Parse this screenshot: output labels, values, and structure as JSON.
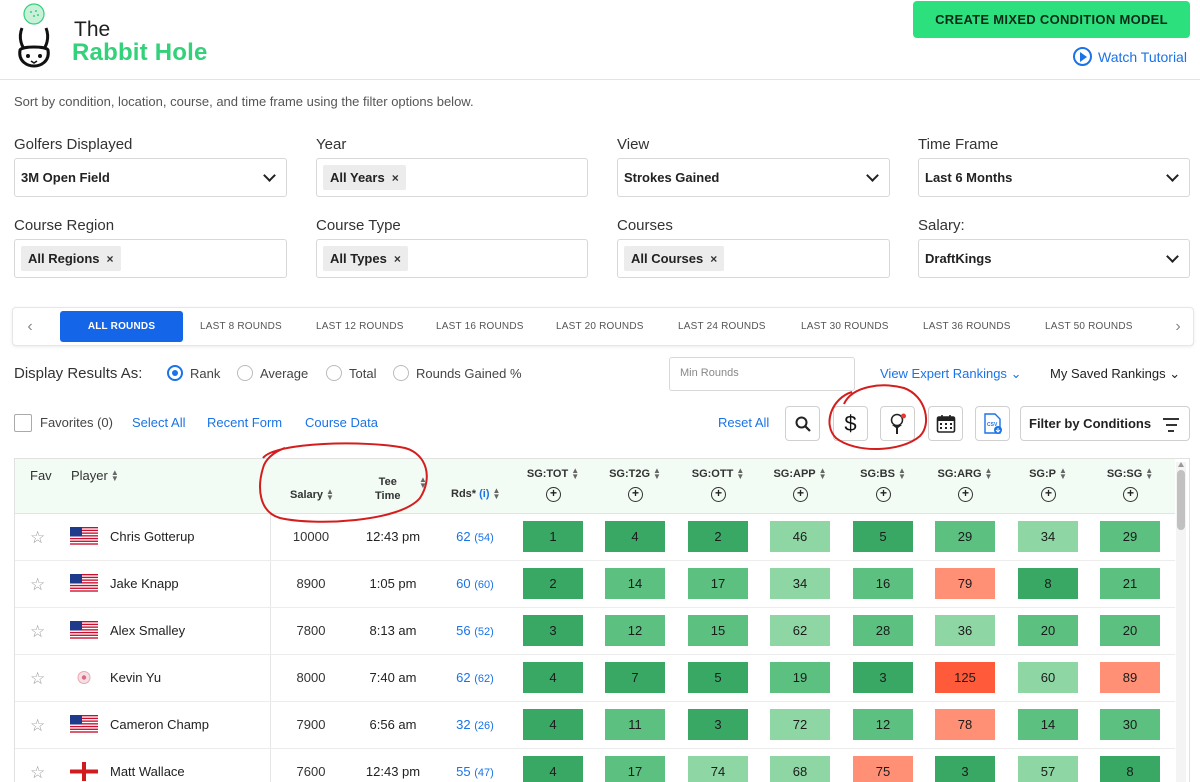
{
  "brand": {
    "line1": "The",
    "line2": "Rabbit Hole"
  },
  "header": {
    "cta_label": "CREATE MIXED CONDITION MODEL",
    "tutorial_label": "Watch Tutorial"
  },
  "subtitle": "Sort by condition, location, course, and time frame using the filter options below.",
  "filters": {
    "golfers": {
      "label": "Golfers Displayed",
      "value": "3M Open Field"
    },
    "year": {
      "label": "Year",
      "chip": "All Years"
    },
    "view": {
      "label": "View",
      "value": "Strokes Gained"
    },
    "timeframe": {
      "label": "Time Frame",
      "value": "Last 6 Months"
    },
    "region": {
      "label": "Course Region",
      "chip": "All Regions"
    },
    "type": {
      "label": "Course Type",
      "chip": "All Types"
    },
    "courses": {
      "label": "Courses",
      "chip": "All Courses"
    },
    "salary": {
      "label": "Salary:",
      "value": "DraftKings"
    }
  },
  "round_tabs": [
    "ALL ROUNDS",
    "LAST 8 ROUNDS",
    "LAST 12 ROUNDS",
    "LAST 16 ROUNDS",
    "LAST 20 ROUNDS",
    "LAST 24 ROUNDS",
    "LAST 30 ROUNDS",
    "LAST 36 ROUNDS",
    "LAST 50 ROUNDS"
  ],
  "display": {
    "label": "Display Results As:",
    "options": [
      "Rank",
      "Average",
      "Total",
      "Rounds Gained %"
    ],
    "selected": "Rank",
    "min_rounds_placeholder": "Min Rounds",
    "expert_label": "View Expert Rankings",
    "saved_label": "My Saved Rankings"
  },
  "toolbar": {
    "favorites": "Favorites (0)",
    "select_all": "Select All",
    "recent_form": "Recent Form",
    "course_data": "Course Data",
    "reset_all": "Reset All",
    "dollar": "$",
    "filter_conditions": "Filter by Conditions"
  },
  "table": {
    "headers": {
      "fav": "Fav",
      "player": "Player",
      "salary": "Salary",
      "tee_line1": "Tee",
      "tee_line2": "Time",
      "rds": "Rds*",
      "rds_info": "(i)",
      "stats": [
        "SG:TOT",
        "SG:T2G",
        "SG:OTT",
        "SG:APP",
        "SG:BS",
        "SG:ARG",
        "SG:P",
        "SG:SG"
      ]
    },
    "rows": [
      {
        "name": "Chris Gotterup",
        "flag": "usa",
        "salary": "10000",
        "tee": "12:43 pm",
        "rds": "62",
        "rds_sub": "(54)",
        "stats": [
          1,
          4,
          2,
          46,
          5,
          29,
          34,
          29
        ]
      },
      {
        "name": "Jake Knapp",
        "flag": "usa",
        "salary": "8900",
        "tee": "1:05 pm",
        "rds": "60",
        "rds_sub": "(60)",
        "stats": [
          2,
          14,
          17,
          34,
          16,
          79,
          8,
          21
        ]
      },
      {
        "name": "Alex Smalley",
        "flag": "usa",
        "salary": "7800",
        "tee": "8:13 am",
        "rds": "56",
        "rds_sub": "(52)",
        "stats": [
          3,
          12,
          15,
          62,
          28,
          36,
          20,
          20
        ]
      },
      {
        "name": "Kevin Yu",
        "flag": "taiwan",
        "salary": "8000",
        "tee": "7:40 am",
        "rds": "62",
        "rds_sub": "(62)",
        "stats": [
          4,
          7,
          5,
          19,
          3,
          125,
          60,
          89
        ]
      },
      {
        "name": "Cameron Champ",
        "flag": "usa",
        "salary": "7900",
        "tee": "6:56 am",
        "rds": "32",
        "rds_sub": "(26)",
        "stats": [
          4,
          11,
          3,
          72,
          12,
          78,
          14,
          30
        ]
      },
      {
        "name": "Matt Wallace",
        "flag": "england",
        "salary": "7600",
        "tee": "12:43 pm",
        "rds": "55",
        "rds_sub": "(47)",
        "stats": [
          4,
          17,
          74,
          68,
          75,
          3,
          57,
          8
        ]
      }
    ]
  },
  "colors": {
    "accent": "#1565e8",
    "cta": "#2de07e",
    "brand_green": "#33d17a",
    "rank_best": "#3aa865",
    "rank_good": "#5cc080",
    "rank_mid": "#8ed7a5",
    "rank_bad": "#ff8f75",
    "rank_worst": "#ff5a3a",
    "annotation": "#d41e1e"
  },
  "icons": {
    "search": "search-icon",
    "dollar": "dollar-icon",
    "golf": "golf-ball-tee-icon",
    "calendar": "calendar-icon",
    "csv": "csv-export-icon",
    "filter": "filter-lines-icon",
    "star": "star-icon"
  }
}
